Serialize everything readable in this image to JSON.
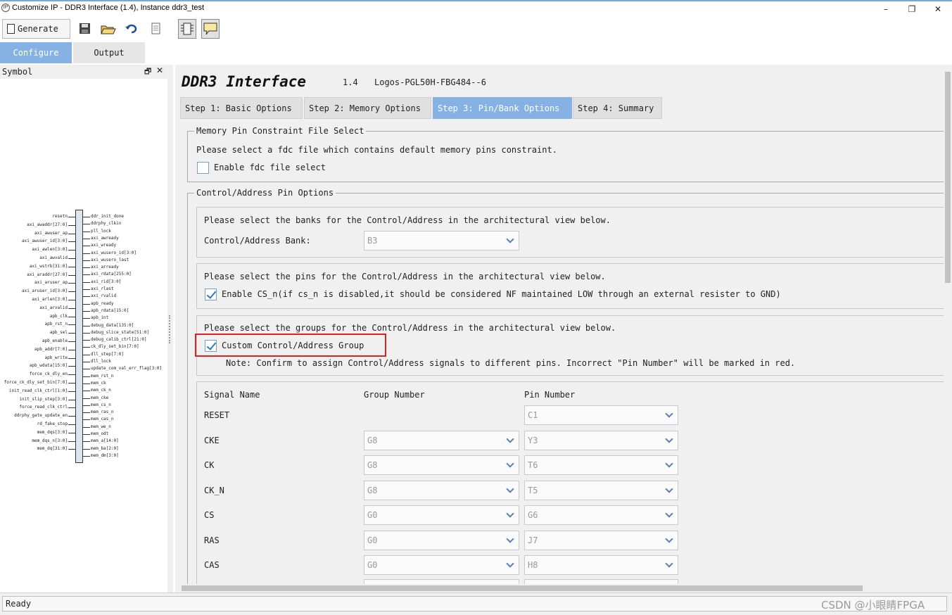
{
  "window": {
    "title": "Customize IP - DDR3 Interface (1.4), Instance ddr3_test",
    "app_icon_text": "IP",
    "controls": {
      "minimize": "–",
      "restore": "❐",
      "close": "✕"
    }
  },
  "toolbar": {
    "generate_label": "Generate",
    "icons": [
      "document-icon",
      "save-icon",
      "open-folder-icon",
      "refresh-icon",
      "notes-icon",
      "chip-icon",
      "comment-icon"
    ]
  },
  "top_tabs": [
    {
      "label": "Configure"
    },
    {
      "label": "Output"
    }
  ],
  "symbol_panel": {
    "title": "Symbol",
    "float_glyph": "🗗",
    "close_glyph": "✕",
    "left_signals": [
      "resetn",
      "axi_awaddr[27:0]",
      "axi_awuser_ap",
      "axi_awuser_id[3:0]",
      "axi_awlen[3:0]",
      "axi_awvalid",
      "axi_wstrb[31:0]",
      "axi_araddr[27:0]",
      "axi_aruser_ap",
      "axi_aruser_id[3:0]",
      "axi_arlen[3:0]",
      "axi_arvalid",
      "apb_clk",
      "apb_rst_n",
      "apb_sel",
      "apb_enable",
      "apb_addr[7:0]",
      "apb_write",
      "apb_wdata[15:0]",
      "force_ck_dly_en",
      "force_ck_dly_set_bin[7:0]",
      "init_read_clk_ctrl[1:0]",
      "init_slip_step[3:0]",
      "force_read_clk_ctrl",
      "ddrphy_gate_update_en",
      "rd_fake_stop",
      "mem_dqs[3:0]",
      "mem_dqs_n[3:0]",
      "mem_dq[31:0]"
    ],
    "right_signals": [
      "ddr_init_done",
      "ddrphy_clkin",
      "pll_lock",
      "axi_awready",
      "axi_wready",
      "axi_wusero_id[3:0]",
      "axi_wusero_last",
      "axi_arready",
      "axi_rdata[255:0]",
      "axi_rid[3:0]",
      "axi_rlast",
      "axi_rvalid",
      "apb_ready",
      "apb_rdata[15:0]",
      "apb_int",
      "debug_data[135:0]",
      "debug_slice_state[51:0]",
      "debug_calib_ctrl[21:0]",
      "ck_dly_set_bin[7:0]",
      "dll_step[7:0]",
      "dll_lock",
      "update_com_val_err_flag[3:0]",
      "mem_rst_n",
      "mem_ck",
      "mem_ck_n",
      "mem_cke",
      "mem_cs_n",
      "mem_ras_n",
      "mem_cas_n",
      "mem_we_n",
      "mem_odt",
      "mem_a[14:0]",
      "mem_ba[2:0]",
      "mem_dm[3:0]"
    ]
  },
  "main": {
    "heading": "DDR3 Interface",
    "version": "1.4",
    "device": "Logos-PGL50H-FBG484--6",
    "step_tabs": [
      {
        "label": "Step 1: Basic Options"
      },
      {
        "label": "Step 2: Memory Options"
      },
      {
        "label": "Step 3: Pin/Bank Options"
      },
      {
        "label": "Step 4: Summary"
      }
    ],
    "active_step": 2,
    "fdc_group": {
      "title": "Memory Pin Constraint File Select",
      "description": "Please select a fdc file which contains default memory pins constraint.",
      "enable_label": "Enable fdc file select",
      "enabled": false
    },
    "ca_group": {
      "title": "Control/Address Pin Options",
      "bank_prompt": "Please select the banks for the Control/Address in the architectural view below.",
      "bank_label": "Control/Address Bank:",
      "bank_value": "B3",
      "pins_prompt": "Please select the pins for the Control/Address in the architectural view below.",
      "cs_label": "Enable CS_n(if cs_n is disabled,it should be considered NF maintained LOW through an external resister to GND)",
      "cs_checked": true,
      "groups_prompt": "Please select the groups for the Control/Address in the architectural view below.",
      "custom_label": "Custom Control/Address Group",
      "custom_checked": true,
      "note": "Note: Confirm to assign Control/Address signals to different pins. Incorrect \"Pin Number\" will be marked in red."
    },
    "signal_table": {
      "headers": {
        "signal": "Signal Name",
        "group": "Group Number",
        "pin": "Pin Number"
      },
      "rows": [
        {
          "signal": "RESET",
          "group": null,
          "pin": "C1"
        },
        {
          "signal": "CKE",
          "group": "G8",
          "pin": "Y3"
        },
        {
          "signal": "CK",
          "group": "G8",
          "pin": "T6"
        },
        {
          "signal": "CK_N",
          "group": "G8",
          "pin": "T5"
        },
        {
          "signal": "CS",
          "group": "G0",
          "pin": "G6"
        },
        {
          "signal": "RAS",
          "group": "G0",
          "pin": "J7"
        },
        {
          "signal": "CAS",
          "group": "G0",
          "pin": "H8"
        }
      ]
    }
  },
  "status": {
    "text": "Ready",
    "watermark": "CSDN @小眼睛FPGA"
  },
  "colors": {
    "accent": "#86b2e3",
    "highlight_box": "#e02020",
    "checkmark": "#2f79c7"
  }
}
